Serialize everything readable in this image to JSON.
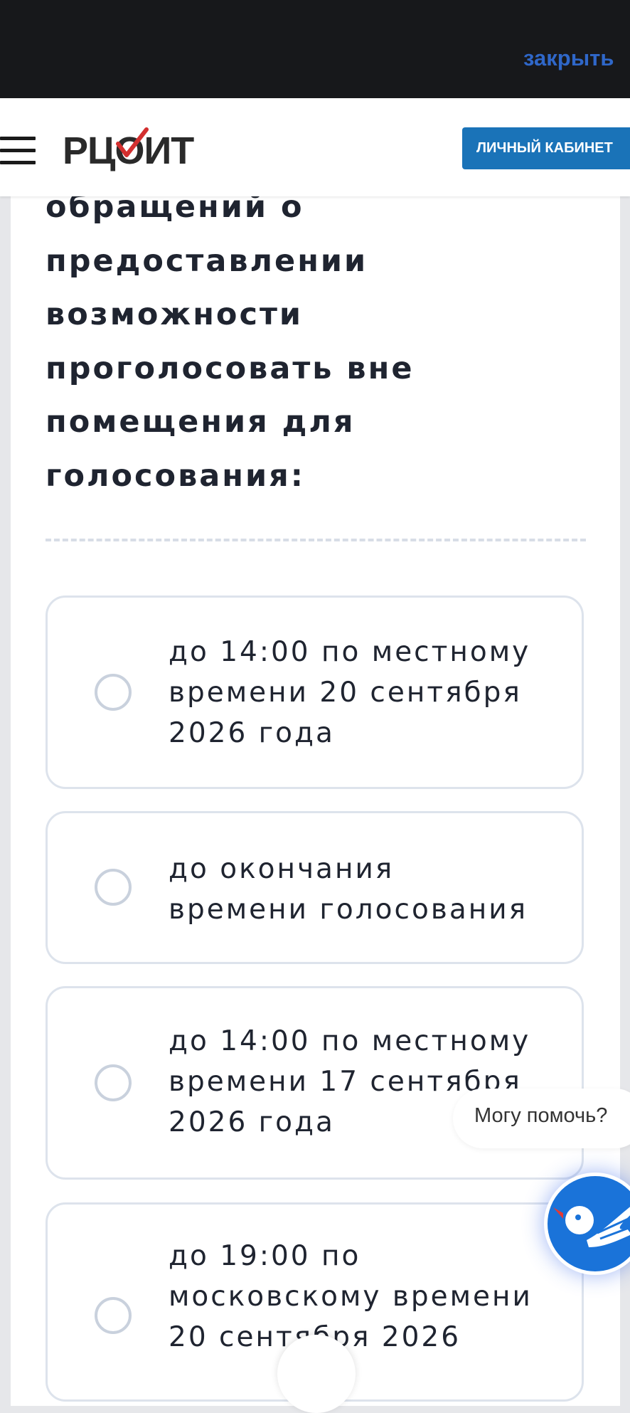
{
  "topbar": {
    "close_label": "закрыть"
  },
  "header": {
    "logo_text": "РЦОИТ",
    "cabinet_label": "ЛИЧНЫЙ КАБИНЕТ"
  },
  "question": {
    "text": "обращений о\nпредоставлении\nвозможности\nпроголосовать вне\nпомещения для\nголосования:"
  },
  "options": [
    {
      "label": "до 14:00 по местному\nвремени 20 сентября\n2026 года"
    },
    {
      "label": "до окончания\nвремени голосования"
    },
    {
      "label": "до 14:00 по местному\nвремени 17 сентября\n2026 года"
    },
    {
      "label": "до 19:00 по\nмосковскому времени\n20 сентября 2026"
    }
  ],
  "help": {
    "bubble_text": "Могу помочь?"
  }
}
